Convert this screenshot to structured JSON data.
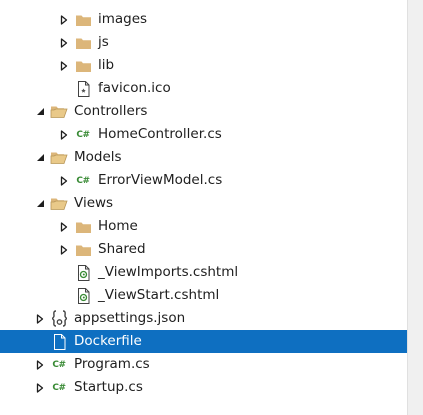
{
  "colors": {
    "selection": "#0e6fc1",
    "folder": "#dcb67a",
    "csharp": "#388a34",
    "text": "#1e1e1e"
  },
  "tree": {
    "items": [
      {
        "label": "images",
        "icon": "folder-icon",
        "expander": "collapsed",
        "level": 1
      },
      {
        "label": "js",
        "icon": "folder-icon",
        "expander": "collapsed",
        "level": 1
      },
      {
        "label": "lib",
        "icon": "folder-icon",
        "expander": "collapsed",
        "level": 1
      },
      {
        "label": "favicon.ico",
        "icon": "image-file-icon",
        "expander": "none",
        "level": 1
      },
      {
        "label": "Controllers",
        "icon": "open-folder-icon",
        "expander": "expanded",
        "level": 0
      },
      {
        "label": "HomeController.cs",
        "icon": "csharp-file-icon",
        "expander": "collapsed",
        "level": 1
      },
      {
        "label": "Models",
        "icon": "open-folder-icon",
        "expander": "expanded",
        "level": 0
      },
      {
        "label": "ErrorViewModel.cs",
        "icon": "csharp-file-icon",
        "expander": "collapsed",
        "level": 1
      },
      {
        "label": "Views",
        "icon": "open-folder-icon",
        "expander": "expanded",
        "level": 0
      },
      {
        "label": "Home",
        "icon": "folder-icon",
        "expander": "collapsed",
        "level": 1
      },
      {
        "label": "Shared",
        "icon": "folder-icon",
        "expander": "collapsed",
        "level": 1
      },
      {
        "label": "_ViewImports.cshtml",
        "icon": "razor-file-icon",
        "expander": "none",
        "level": 1
      },
      {
        "label": "_ViewStart.cshtml",
        "icon": "razor-file-icon",
        "expander": "none",
        "level": 1
      },
      {
        "label": "appsettings.json",
        "icon": "json-file-icon",
        "expander": "collapsed",
        "level": 0
      },
      {
        "label": "Dockerfile",
        "icon": "file-icon",
        "expander": "none",
        "level": 0,
        "selected": true
      },
      {
        "label": "Program.cs",
        "icon": "csharp-file-icon",
        "expander": "collapsed",
        "level": 0
      },
      {
        "label": "Startup.cs",
        "icon": "csharp-file-icon",
        "expander": "collapsed",
        "level": 0
      }
    ]
  }
}
